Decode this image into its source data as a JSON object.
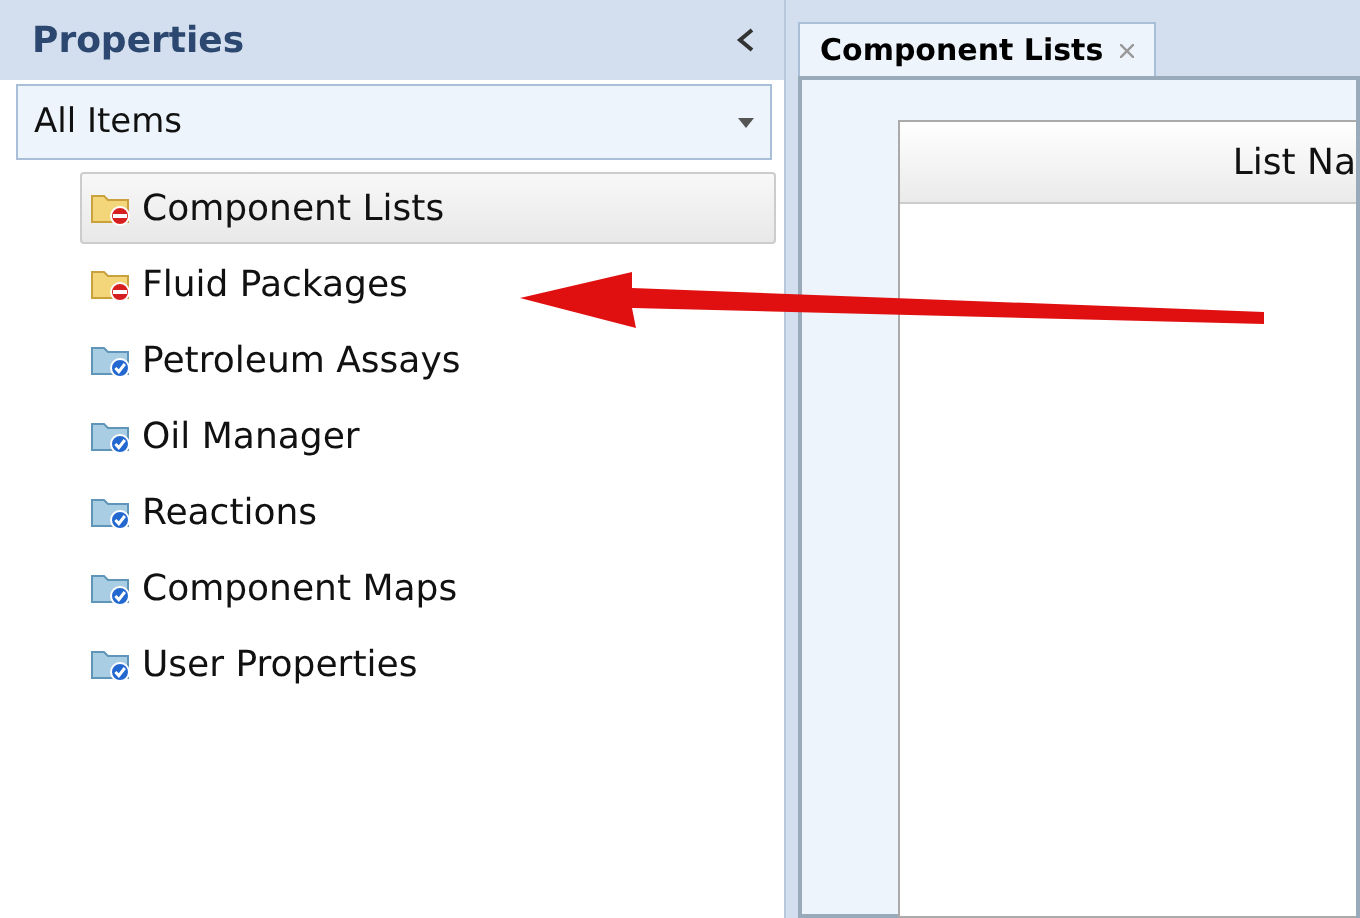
{
  "sidebar": {
    "title": "Properties",
    "filter": {
      "value": "All Items"
    },
    "items": [
      {
        "label": "Component Lists",
        "kind": "incomplete",
        "selected": true
      },
      {
        "label": "Fluid Packages",
        "kind": "incomplete",
        "selected": false
      },
      {
        "label": "Petroleum Assays",
        "kind": "complete",
        "selected": false
      },
      {
        "label": "Oil Manager",
        "kind": "complete",
        "selected": false
      },
      {
        "label": "Reactions",
        "kind": "complete",
        "selected": false
      },
      {
        "label": "Component Maps",
        "kind": "complete",
        "selected": false
      },
      {
        "label": "User Properties",
        "kind": "complete",
        "selected": false
      }
    ]
  },
  "tabs": [
    {
      "label": "Component Lists",
      "selected": true
    }
  ],
  "table": {
    "columns": [
      "List Na"
    ]
  }
}
